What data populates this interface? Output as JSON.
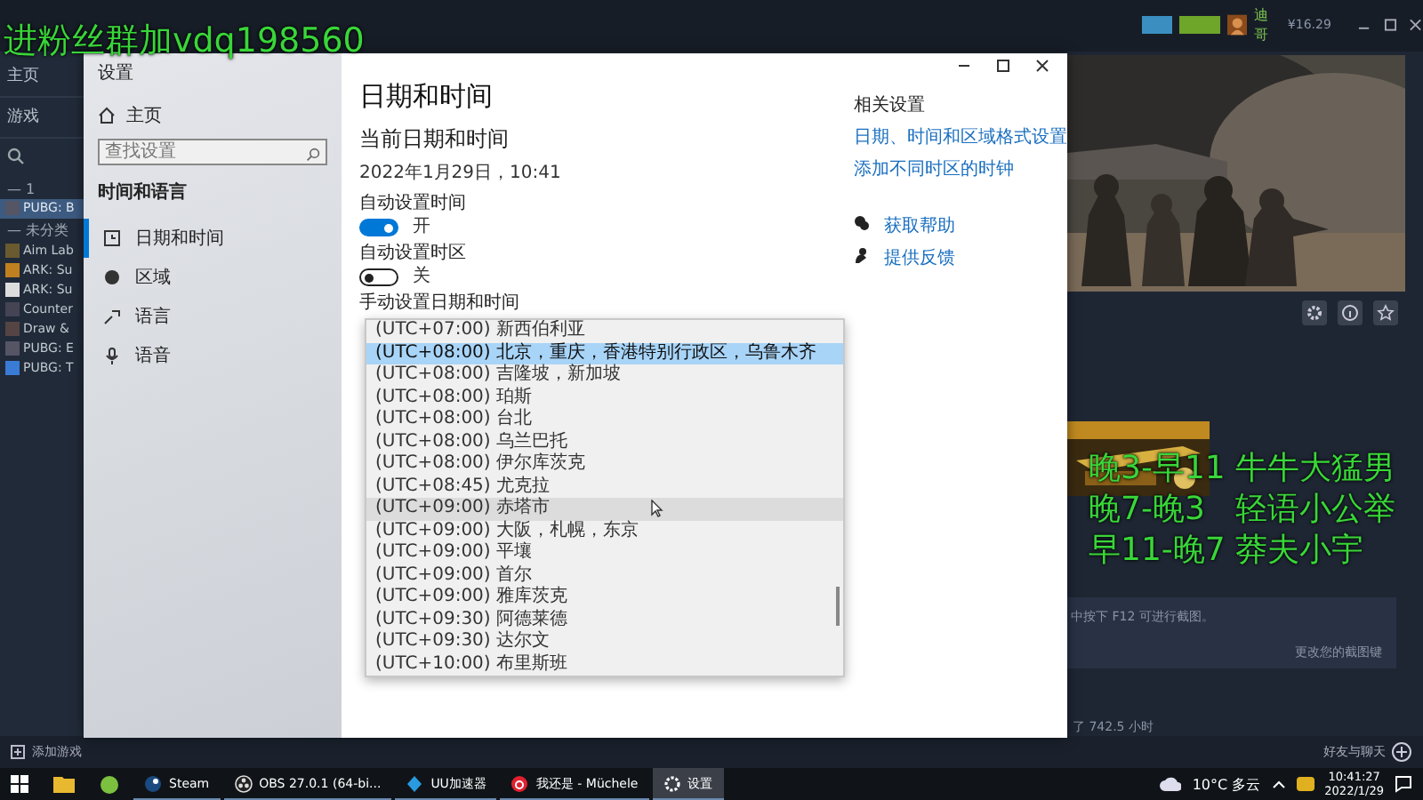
{
  "steam": {
    "top_bar": {
      "user": "迪哥",
      "balance": "¥16.29"
    },
    "sidebar": {
      "home": "主页",
      "games": "游戏",
      "groups": [
        {
          "title": "— 1",
          "games": [
            {
              "name": "PUBG: B",
              "selected": true
            }
          ]
        },
        {
          "title": "— 未分类",
          "games": [
            {
              "name": "Aim Lab",
              "selected": false
            },
            {
              "name": "ARK: Su",
              "selected": false
            },
            {
              "name": "ARK: Su",
              "selected": false
            },
            {
              "name": "Counter",
              "selected": false
            },
            {
              "name": "Draw &",
              "selected": false
            },
            {
              "name": "PUBG: E",
              "selected": false
            },
            {
              "name": "PUBG: T",
              "selected": false
            }
          ]
        }
      ]
    },
    "screenshot_note": "中按下 F12 可进行截图。",
    "screenshot_link": "更改您的截图键",
    "playtime": "了 742.5 小时",
    "add_game": "添加游戏",
    "friends": "好友与聊天"
  },
  "settings": {
    "window_title": "设置",
    "nav": {
      "home": "主页",
      "search_placeholder": "查找设置",
      "section": "时间和语言",
      "items": [
        {
          "label": "日期和时间",
          "selected": true
        },
        {
          "label": "区域",
          "selected": false
        },
        {
          "label": "语言",
          "selected": false
        },
        {
          "label": "语音",
          "selected": false
        }
      ]
    },
    "heading": "日期和时间",
    "subheading": "当前日期和时间",
    "current": "2022年1月29日，10:41",
    "toggles": [
      {
        "label": "自动设置时间",
        "on": true,
        "state": "开"
      },
      {
        "label": "自动设置时区",
        "on": false,
        "state": "关"
      }
    ],
    "manual_label": "手动设置日期和时间",
    "related": {
      "title": "相关设置",
      "links": [
        "日期、时间和区域格式设置",
        "添加不同时区的时钟"
      ]
    },
    "help": [
      {
        "label": "获取帮助"
      },
      {
        "label": "提供反馈"
      }
    ],
    "timezones": [
      {
        "label": "(UTC+07:00) 新西伯利亚",
        "selected": false,
        "hovered": false
      },
      {
        "label": "(UTC+08:00) 北京，重庆，香港特别行政区，乌鲁木齐",
        "selected": true,
        "hovered": false
      },
      {
        "label": "(UTC+08:00) 吉隆坡，新加坡",
        "selected": false,
        "hovered": false
      },
      {
        "label": "(UTC+08:00) 珀斯",
        "selected": false,
        "hovered": false
      },
      {
        "label": "(UTC+08:00) 台北",
        "selected": false,
        "hovered": false
      },
      {
        "label": "(UTC+08:00) 乌兰巴托",
        "selected": false,
        "hovered": false
      },
      {
        "label": "(UTC+08:00) 伊尔库茨克",
        "selected": false,
        "hovered": false
      },
      {
        "label": "(UTC+08:45) 尤克拉",
        "selected": false,
        "hovered": false
      },
      {
        "label": "(UTC+09:00) 赤塔市",
        "selected": false,
        "hovered": true
      },
      {
        "label": "(UTC+09:00) 大阪，札幌，东京",
        "selected": false,
        "hovered": false
      },
      {
        "label": "(UTC+09:00) 平壤",
        "selected": false,
        "hovered": false
      },
      {
        "label": "(UTC+09:00) 首尔",
        "selected": false,
        "hovered": false
      },
      {
        "label": "(UTC+09:00) 雅库茨克",
        "selected": false,
        "hovered": false
      },
      {
        "label": "(UTC+09:30) 阿德莱德",
        "selected": false,
        "hovered": false
      },
      {
        "label": "(UTC+09:30) 达尔文",
        "selected": false,
        "hovered": false
      },
      {
        "label": "(UTC+10:00) 布里斯班",
        "selected": false,
        "hovered": false
      }
    ]
  },
  "overlay": {
    "promo": "进粉丝群加vdq198560",
    "schedule": [
      "晚3-早11 牛牛大猛男",
      "晚7-晚3   轻语小公举",
      "早11-晚7 莽夫小宇"
    ]
  },
  "taskbar": {
    "apps": [
      {
        "kind": "steam",
        "label": "Steam",
        "selected": false
      },
      {
        "kind": "obs",
        "label": "OBS 27.0.1 (64-bi...",
        "selected": false
      },
      {
        "kind": "uu",
        "label": "UU加速器",
        "selected": false
      },
      {
        "kind": "music",
        "label": "我还是 - Müchele",
        "selected": false
      },
      {
        "kind": "settings",
        "label": "设置",
        "selected": true
      }
    ],
    "weather": "10°C 多云",
    "time": "10:41:27",
    "date": "2022/1/29"
  }
}
